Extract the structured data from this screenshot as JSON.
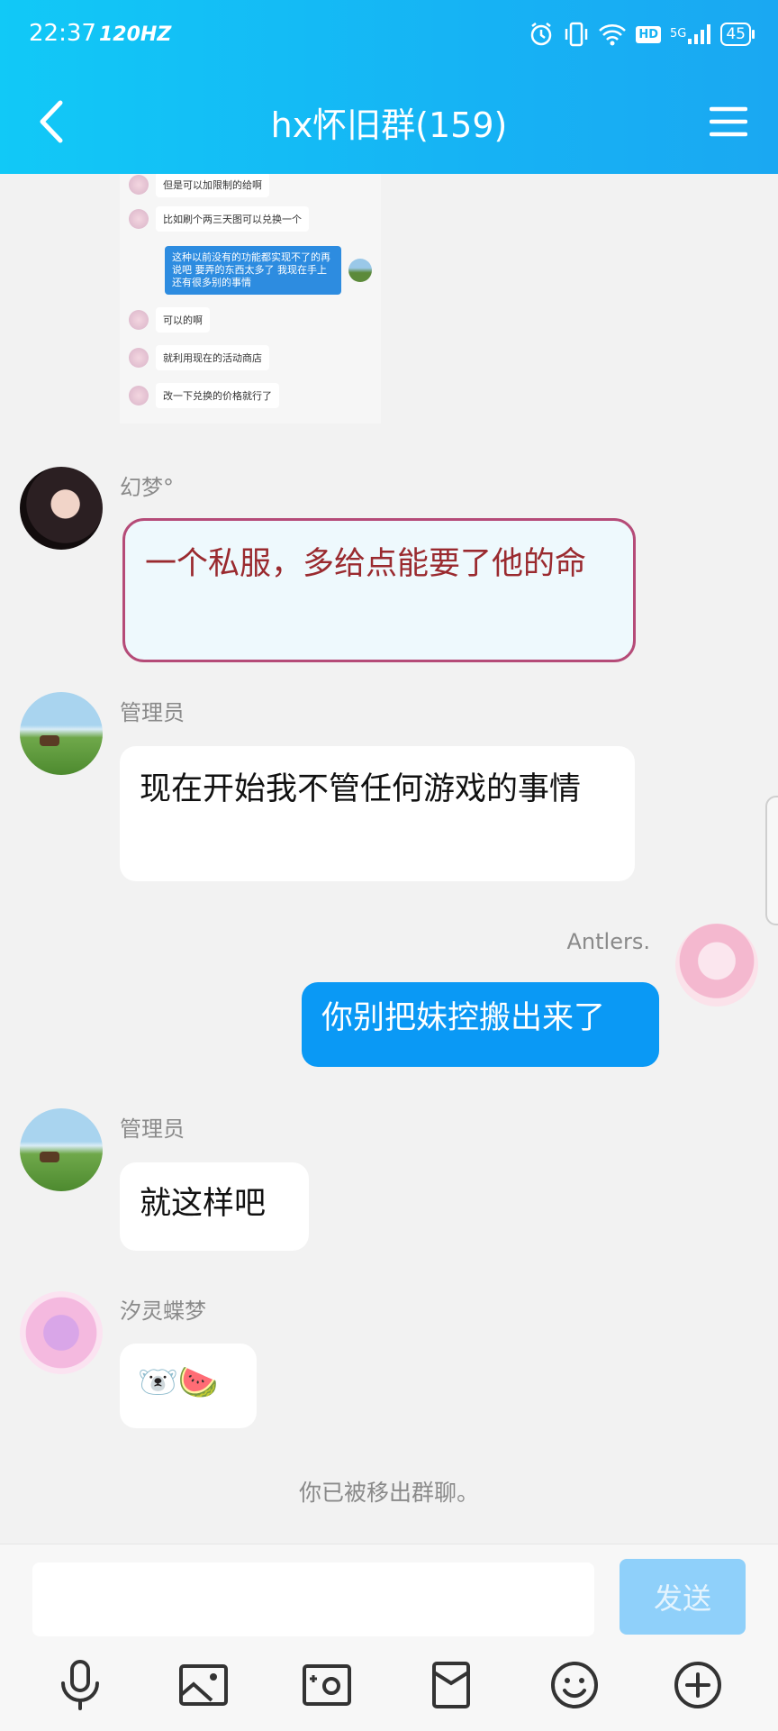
{
  "status_bar": {
    "time": "22:37",
    "refresh": "120HZ",
    "network": "5G",
    "hd": "HD",
    "battery": "45"
  },
  "header": {
    "title": "hx怀旧群(159)"
  },
  "screenshot_image": {
    "messages": [
      {
        "side": "left",
        "text": "但是可以加限制的给啊"
      },
      {
        "side": "left",
        "text": "比如刷个两三天图可以兑换一个"
      },
      {
        "side": "right",
        "text": "这种以前没有的功能都实现不了的再说吧 要弄的东西太多了 我现在手上还有很多别的事情"
      },
      {
        "side": "left",
        "text": "可以的啊"
      },
      {
        "side": "left",
        "text": "就利用现在的活动商店"
      },
      {
        "side": "left",
        "text": "改一下兑换的价格就行了"
      }
    ]
  },
  "messages": [
    {
      "sender": "幻梦°",
      "text": "一个私服，多给点能要了他的命"
    },
    {
      "sender": "管理员",
      "text": "现在开始我不管任何游戏的事情"
    },
    {
      "sender": "Antlers.",
      "text": "你别把妹控搬出来了"
    },
    {
      "sender": "管理员",
      "text": "就这样吧"
    },
    {
      "sender": "汐灵蝶梦",
      "text": "🐻‍❄️🍉"
    }
  ],
  "system_notice": "你已被移出群聊。",
  "input": {
    "placeholder": "",
    "send_label": "发送"
  },
  "toolbar": [
    "microphone-icon",
    "image-icon",
    "camera-icon",
    "red-packet-icon",
    "emoji-icon",
    "plus-icon"
  ]
}
